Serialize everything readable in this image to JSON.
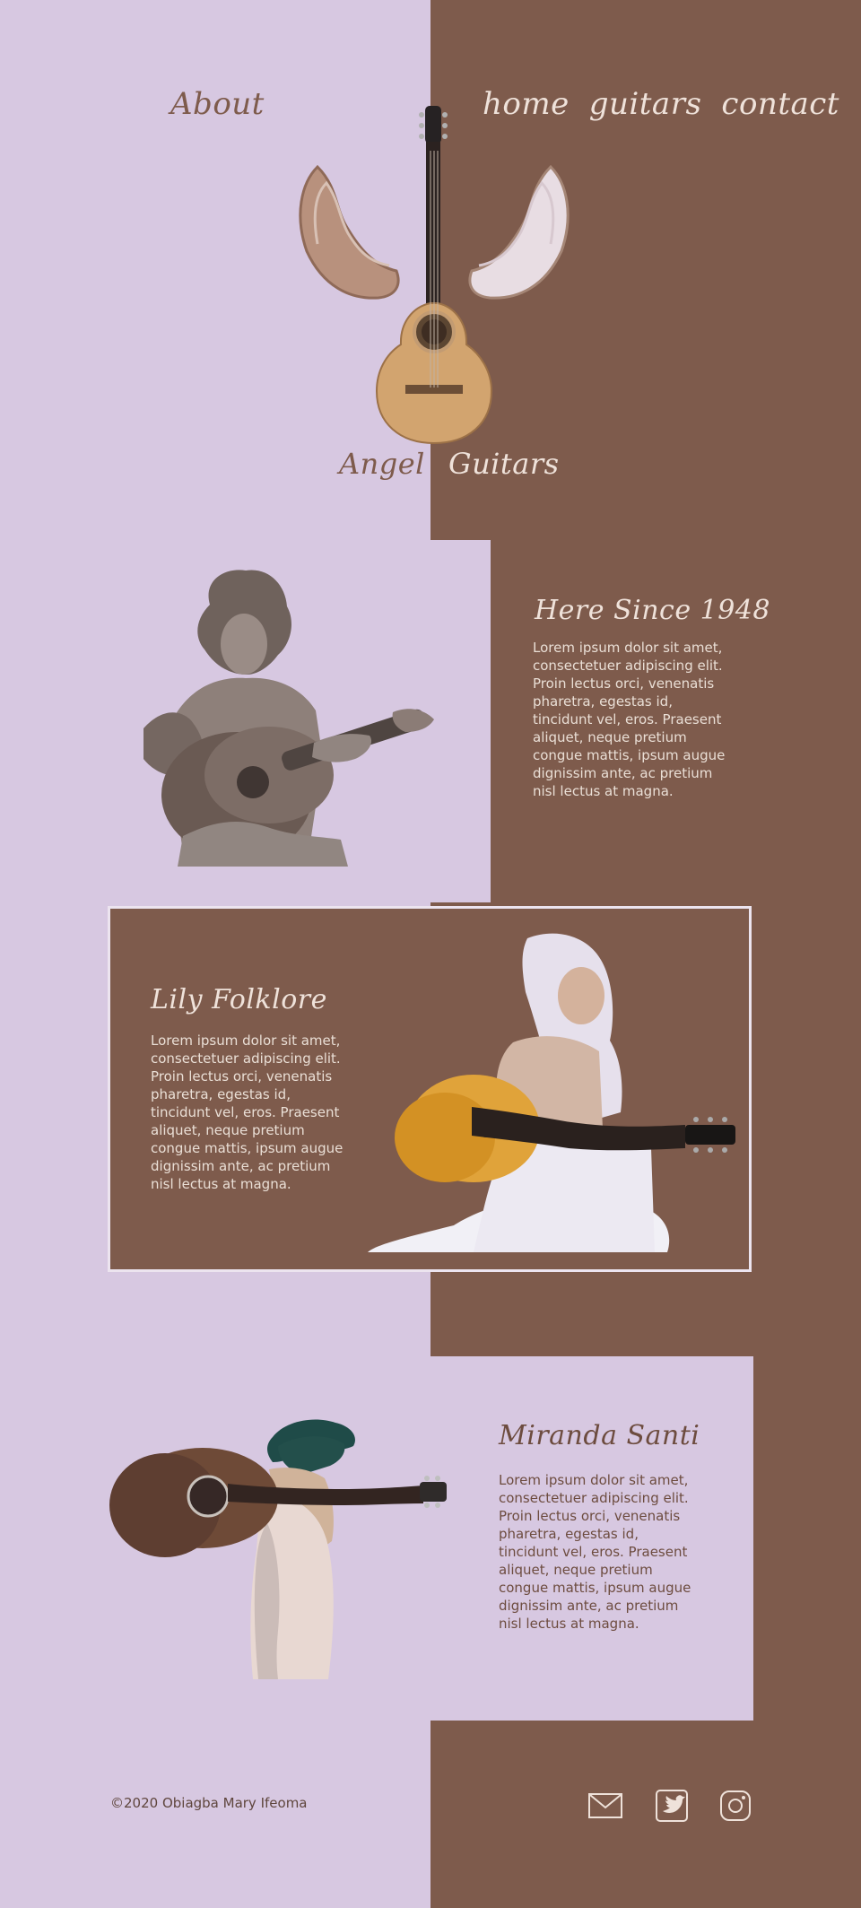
{
  "header": {
    "about_label": "About",
    "nav": [
      {
        "label": "home"
      },
      {
        "label": "guitars"
      },
      {
        "label": "contact"
      }
    ],
    "brand": {
      "left": "Angel",
      "right": "Guitars"
    }
  },
  "sections": {
    "here_since": {
      "title": "Here Since 1948",
      "body": "Lorem ipsum dolor sit amet, consectetuer adipiscing elit. Proin lectus orci, venenatis pharetra, egestas id, tincidunt vel, eros. Praesent aliquet, neque pretium congue mattis, ipsum augue dignissim ante, ac pretium nisl lectus at magna."
    },
    "lily": {
      "title": "Lily Folklore",
      "body": "Lorem ipsum dolor sit amet, consectetuer adipiscing elit. Proin lectus orci, venenatis pharetra, egestas id, tincidunt vel, eros. Praesent aliquet, neque pretium congue mattis, ipsum augue dignissim ante, ac pretium nisl lectus at magna."
    },
    "miranda": {
      "title": "Miranda Santi",
      "body": "Lorem ipsum dolor sit amet, consectetuer adipiscing elit. Proin lectus orci, venenatis pharetra, egestas id, tincidunt vel, eros. Praesent aliquet, neque pretium congue mattis, ipsum augue dignissim ante, ac pretium nisl lectus at magna."
    }
  },
  "footer": {
    "copyright": "©2020 Obiagba Mary Ifeoma",
    "icons": [
      "mail-icon",
      "twitter-icon",
      "instagram-icon"
    ]
  },
  "colors": {
    "lavender": "#d7c8e1",
    "brown": "#7e5b4c",
    "light_text": "#efe2da",
    "dark_text": "#6d4c3f"
  }
}
